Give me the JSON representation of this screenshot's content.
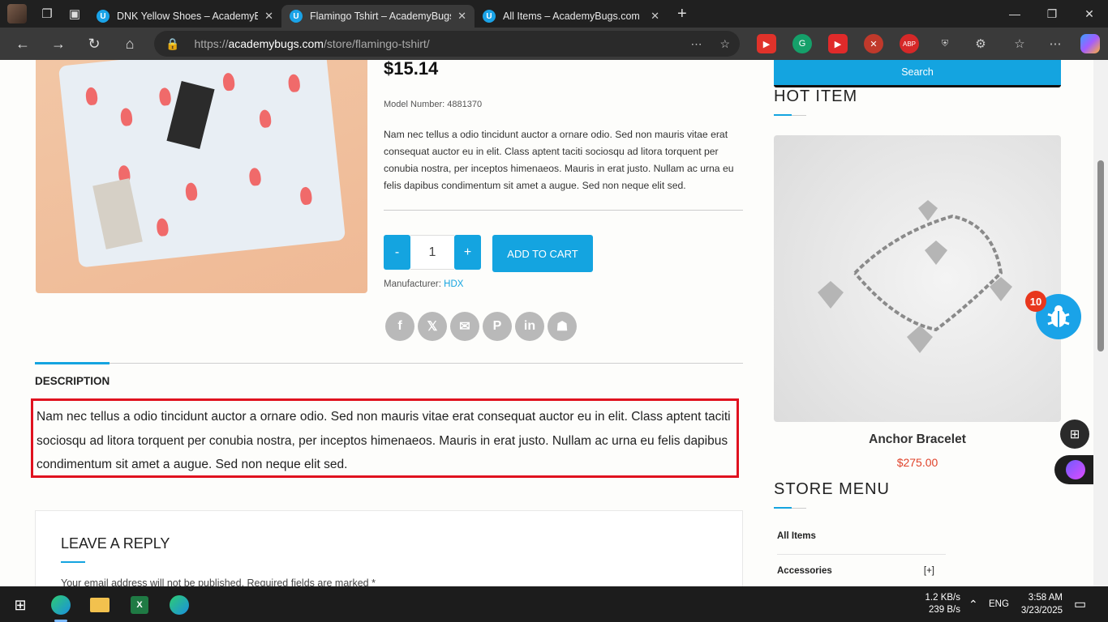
{
  "browser": {
    "tabs": [
      {
        "title": "DNK Yellow Shoes – AcademyBug",
        "active": false
      },
      {
        "title": "Flamingo Tshirt – AcademyBugs.c",
        "active": true
      },
      {
        "title": "All Items – AcademyBugs.com",
        "active": false
      }
    ],
    "url_prefix": "https://",
    "url_host": "academybugs.com",
    "url_path": "/store/flamingo-tshirt/",
    "extensions": [
      "ABP"
    ]
  },
  "product": {
    "price": "$15.14",
    "model_number": "Model Number: 4881370",
    "short_description": "Nam nec tellus a odio tincidunt auctor a ornare odio. Sed non mauris vitae erat consequat auctor eu in elit. Class aptent taciti sociosqu ad litora torquent per conubia nostra, per inceptos himenaeos. Mauris in erat justo. Nullam ac urna eu felis dapibus condimentum sit amet a augue. Sed non neque elit sed.",
    "qty_minus": "-",
    "qty_value": "1",
    "qty_plus": "+",
    "add_to_cart": "ADD TO CART",
    "manufacturer_label": "Manufacturer:",
    "manufacturer_value": "HDX",
    "share_icons": [
      "facebook-icon",
      "x-icon",
      "email-icon",
      "pinterest-icon",
      "linkedin-icon",
      "myspace-icon"
    ]
  },
  "tabs": {
    "description_label": "DESCRIPTION",
    "description_text": "Nam nec tellus a odio tincidunt auctor a ornare odio. Sed non mauris vitae erat consequat auctor eu in elit. Class aptent taciti sociosqu ad litora torquent per conubia nostra, per inceptos himenaeos. Mauris in erat justo. Nullam ac urna eu felis dapibus condimentum sit amet a augue. Sed non neque elit sed."
  },
  "reply": {
    "heading": "LEAVE A REPLY",
    "note": "Your email address will not be published. Required fields are marked *"
  },
  "sidebar": {
    "search_button": "Search",
    "hot_item_heading": "HOT ITEM",
    "hot_item_name": "Anchor Bracelet",
    "hot_item_price": "$275.00",
    "store_menu_heading": "STORE MENU",
    "menu_items": [
      {
        "label": "All Items",
        "toggle": ""
      },
      {
        "label": "Accessories",
        "toggle": "[+]"
      }
    ]
  },
  "floating": {
    "bug_badge": "10"
  },
  "taskbar": {
    "net_up": "1.2 KB/s",
    "net_down": "239 B/s",
    "lang": "ENG",
    "time": "3:58 AM",
    "date": "3/23/2025"
  },
  "colors": {
    "accent": "#14a4e0",
    "highlight_border": "#e0121f",
    "price_red": "#e0422a"
  }
}
